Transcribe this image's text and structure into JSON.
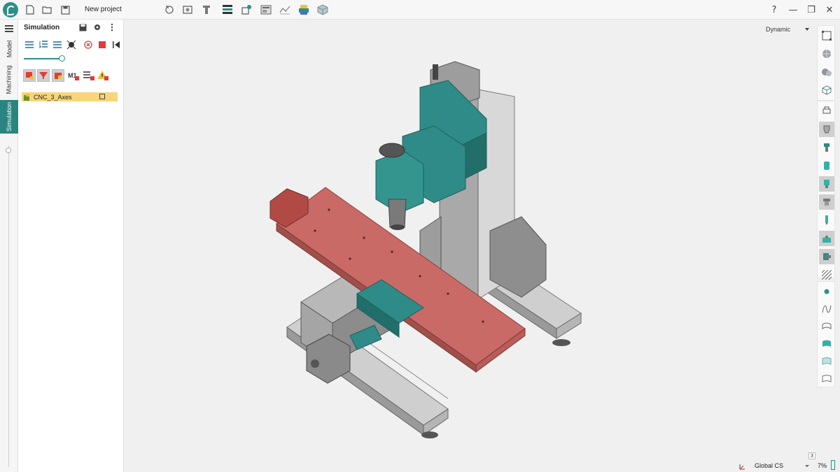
{
  "app": {
    "project_title": "New project"
  },
  "window": {
    "help": "?",
    "minimize": "—",
    "restore": "❐",
    "close": "✕"
  },
  "vtabs": {
    "model": "Model",
    "machining": "Machining",
    "simulation": "Simulation"
  },
  "panel": {
    "title": "Simulation",
    "tree": [
      {
        "label": "CNC_3_Axes"
      }
    ]
  },
  "viewport": {
    "view_mode": "Dynamic"
  },
  "status": {
    "coord_system": "Global CS",
    "zoom": "7%",
    "badge": "3"
  },
  "colors": {
    "accent": "#2a8580",
    "table": "#c96a66",
    "teal_part": "#2f8b87",
    "selection": "#f7d57a"
  },
  "icons": {
    "toolbar": [
      "new-file-icon",
      "open-folder-icon",
      "save-icon",
      "rotate-view-icon",
      "zoom-fit-icon",
      "tool-library-icon",
      "gcode-icon",
      "machine-setup-icon",
      "stock-icon",
      "toolpath-icon",
      "printer-icon",
      "cube-view-icon"
    ]
  }
}
